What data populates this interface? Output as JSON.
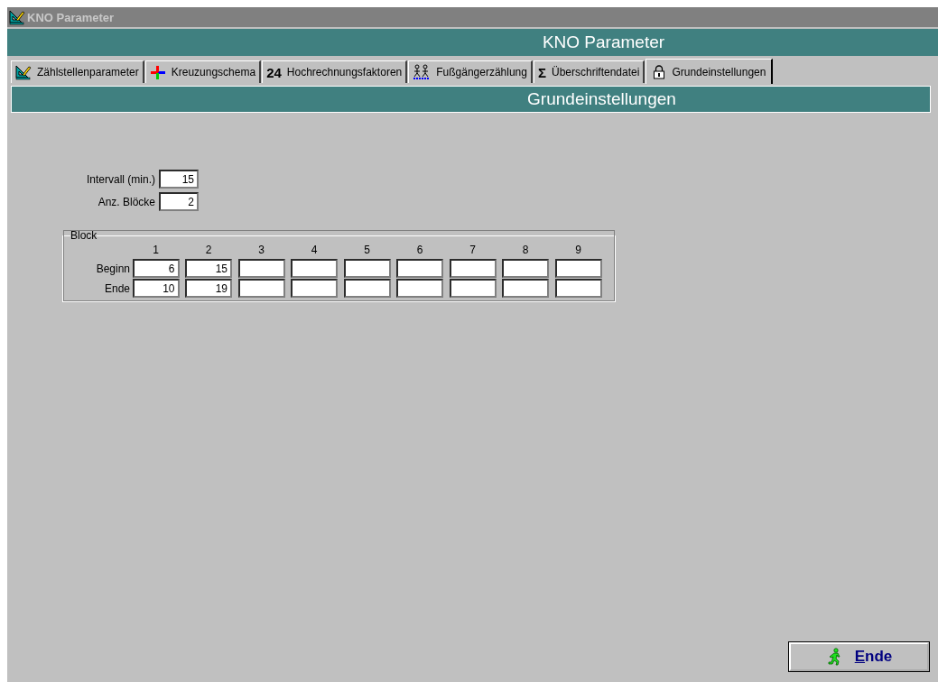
{
  "window": {
    "title": "KNO Parameter"
  },
  "header": "KNO Parameter",
  "tabs": [
    {
      "label": "Zählstellenparameter",
      "selected": false
    },
    {
      "label": "Kreuzungschema",
      "selected": false
    },
    {
      "label": "Hochrechnungsfaktoren",
      "symbol": "24",
      "selected": false
    },
    {
      "label": "Fußgängerzählung",
      "selected": false
    },
    {
      "label": "Überschriftendatei",
      "symbol": "Σ",
      "selected": false
    },
    {
      "label": "Grundeinstellungen",
      "selected": true
    }
  ],
  "section_title": "Grundeinstellungen",
  "fields": [
    {
      "label": "Intervall (min.)",
      "value": "15"
    },
    {
      "label": "Anz. Blöcke",
      "value": "2"
    }
  ],
  "block": {
    "title": "Block",
    "columns": [
      "1",
      "2",
      "3",
      "4",
      "5",
      "6",
      "7",
      "8",
      "9"
    ],
    "rows": [
      {
        "label": "Beginn",
        "values": [
          "6",
          "15"
        ]
      },
      {
        "label": "Ende",
        "values": [
          "10",
          "19"
        ]
      }
    ]
  },
  "button": {
    "label": "Ende"
  }
}
